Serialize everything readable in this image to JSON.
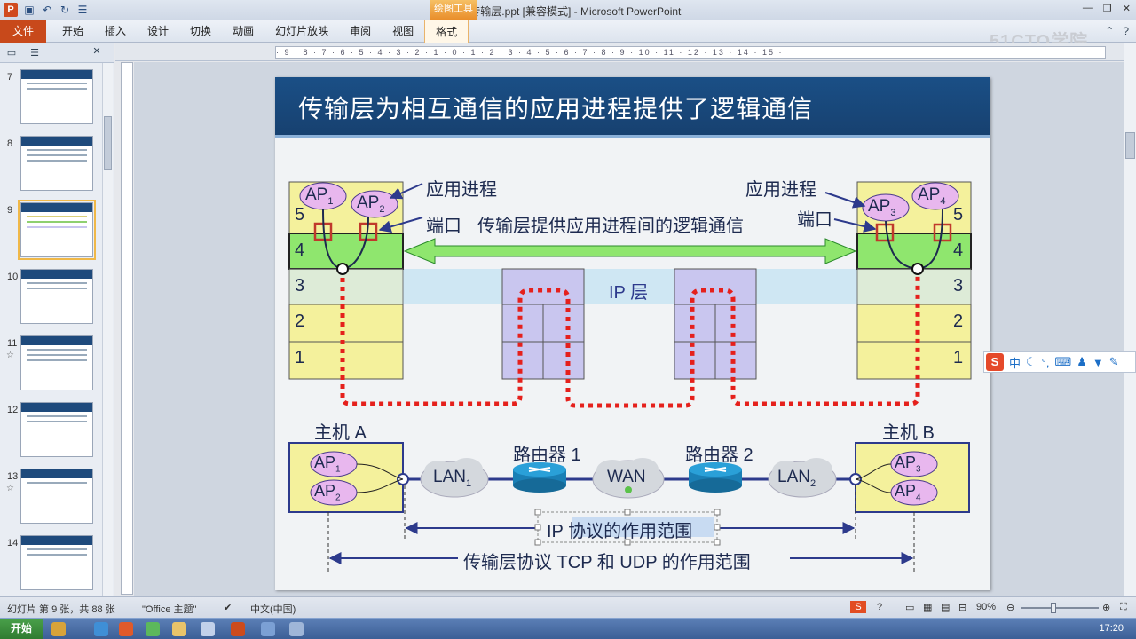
{
  "app": {
    "icon_letter": "P",
    "doc_title": "05 传输层.ppt [兼容模式] - Microsoft PowerPoint",
    "contextual_tab_group": "绘图工具"
  },
  "qat": [
    "save-icon",
    "undo-icon",
    "redo-icon",
    "menu-icon"
  ],
  "ribbon": {
    "file_tab": "文件",
    "tabs": [
      "开始",
      "插入",
      "设计",
      "切换",
      "动画",
      "幻灯片放映",
      "审阅",
      "视图",
      "格式"
    ],
    "watermark": "51CTO学院"
  },
  "left_pane": {
    "slides": [
      {
        "num": "7",
        "star": ""
      },
      {
        "num": "8",
        "star": ""
      },
      {
        "num": "9",
        "star": ""
      },
      {
        "num": "10",
        "star": ""
      },
      {
        "num": "11",
        "star": "☆"
      },
      {
        "num": "12",
        "star": ""
      },
      {
        "num": "13",
        "star": "☆"
      },
      {
        "num": "14",
        "star": ""
      }
    ],
    "selected_slide": "9"
  },
  "ruler": {
    "h_ticks": "· 9 · 8 · 7 · 6 · 5 · 4 · 3 · 2 · 1 · 0 · 1 · 2 · 3 · 4 · 5 · 6 · 7 · 8 · 9 · 10 · 11 · 12 · 13 · 14 · 15 ·",
    "v_ticks": "9 8 7 6 5 4 3 2 1 0 1 2 3 4 5 6 7 8 9"
  },
  "slide": {
    "title": "传输层为相互通信的应用进程提供了逻辑通信",
    "labels": {
      "app_process_left": "应用进程",
      "app_process_right": "应用进程",
      "port_left": "端口",
      "port_right": "端口",
      "logical_comm": "传输层提供应用进程间的逻辑通信",
      "ip_layer": "IP 层",
      "host_a": "主机 A",
      "host_b": "主机 B",
      "router1": "路由器 1",
      "router2": "路由器 2",
      "ip_scope": "IP 协议的作用范围",
      "tcp_udp_scope": "传输层协议 TCP 和 UDP 的作用范围"
    },
    "layers": [
      "5",
      "4",
      "3",
      "2",
      "1"
    ],
    "ap": {
      "base": "AP",
      "subs": [
        "1",
        "2",
        "3",
        "4"
      ]
    },
    "lan": {
      "base": "LAN",
      "subs": [
        "1",
        "2"
      ]
    },
    "wan": "WAN"
  },
  "ime": {
    "logo": "S",
    "mode": "中"
  },
  "status": {
    "slide_info": "幻灯片 第 9 张，共 88 张",
    "theme": "\"Office 主题\"",
    "language": "中文(中国)",
    "zoom": "90%"
  },
  "taskbar": {
    "start": "开始",
    "clock": "17:20"
  },
  "colors": {
    "title_bar": "#1a4f86",
    "layer_yellow": "#f4f19c",
    "layer_green": "#8fe66e",
    "ip_band": "#cfe7f3",
    "router_box": "#c9c6ef",
    "ap_ellipse": "#e8b7ee",
    "red_dots": "#e5201c",
    "file_tab": "#c8491b"
  }
}
